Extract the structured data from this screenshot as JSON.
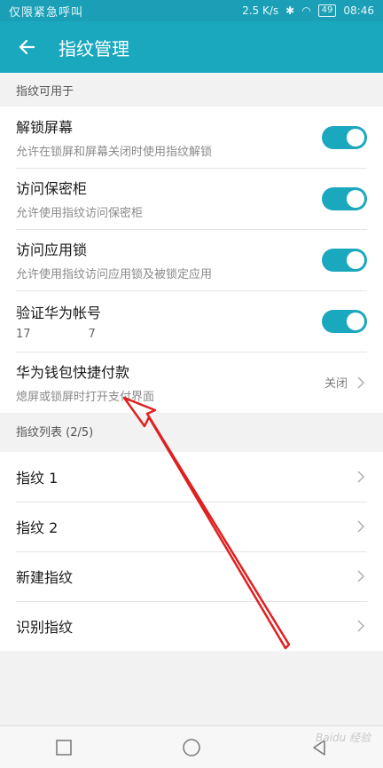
{
  "status_bar": {
    "carrier": "仅限紧急呼叫",
    "speed": "2.5 K/s",
    "battery": "49",
    "time": "08:46"
  },
  "app_bar": {
    "title": "指纹管理"
  },
  "section1": {
    "title": "指纹可用于"
  },
  "settings": [
    {
      "title": "解锁屏幕",
      "subtitle": "允许在锁屏和屏幕关闭时使用指纹解锁",
      "on": true
    },
    {
      "title": "访问保密柜",
      "subtitle": "允许使用指纹访问保密柜",
      "on": true
    },
    {
      "title": "访问应用锁",
      "subtitle": "允许使用指纹访问应用锁及被锁定应用",
      "on": true
    },
    {
      "title": "验证华为帐号",
      "subtitle": "17     7",
      "on": true
    }
  ],
  "wallet": {
    "title": "华为钱包快捷付款",
    "subtitle": "熄屏或锁屏时打开支付界面",
    "status": "关闭"
  },
  "section2": {
    "title": "指纹列表 (2/5)"
  },
  "fingerprints": [
    {
      "label": "指纹 1"
    },
    {
      "label": "指纹 2"
    },
    {
      "label": "新建指纹"
    },
    {
      "label": "识别指纹"
    }
  ],
  "watermark": "Baidu 经验",
  "colors": {
    "accent": "#1aa8bf",
    "annotation": "#e02020"
  }
}
